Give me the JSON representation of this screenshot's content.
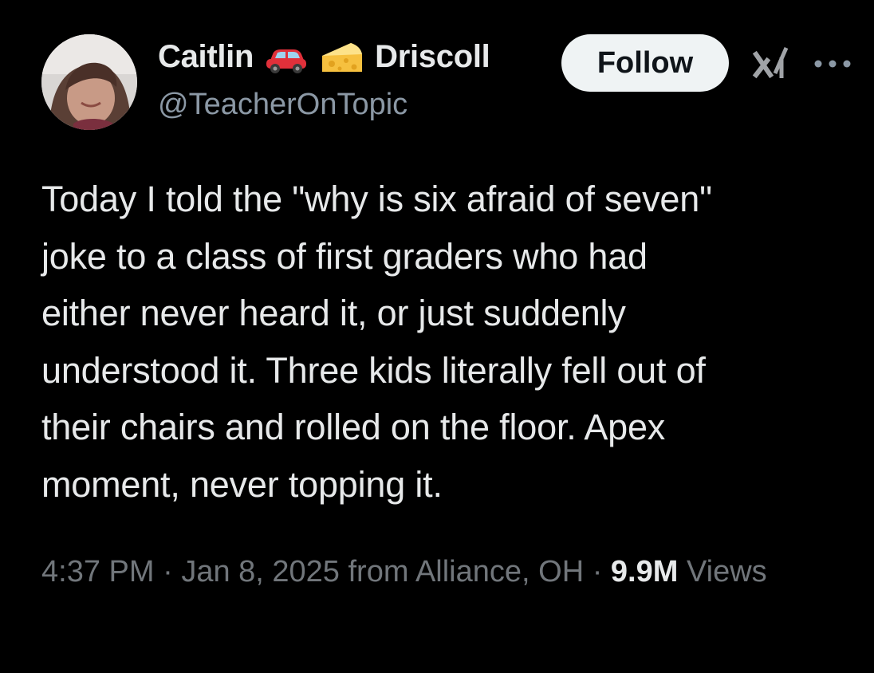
{
  "user": {
    "first_name": "Caitlin",
    "last_name": "Driscoll",
    "emoji_1": "car-emoji",
    "emoji_2": "cheese-emoji",
    "handle": "@TeacherOnTopic",
    "avatar": "profile-photo"
  },
  "actions": {
    "follow_label": "Follow",
    "grok_icon": "grok-icon",
    "more_icon": "more-icon"
  },
  "tweet": {
    "text": "Today I told the \"why is six afraid of seven\"\njoke to a class of first graders who had\neither never heard it, or just suddenly\nunderstood it. Three kids literally fell out of\ntheir chairs and rolled on the floor. Apex\nmoment, never topping it.",
    "time": "4:37 PM",
    "separator": "·",
    "date": "Jan 8, 2025",
    "location": "from Alliance, OH",
    "views_count": "9.9M",
    "views_label": "Views"
  },
  "colors": {
    "background": "#000000",
    "primary_text": "#e7e9ea",
    "secondary_text": "#71767b",
    "follow_bg": "#eff3f4"
  }
}
